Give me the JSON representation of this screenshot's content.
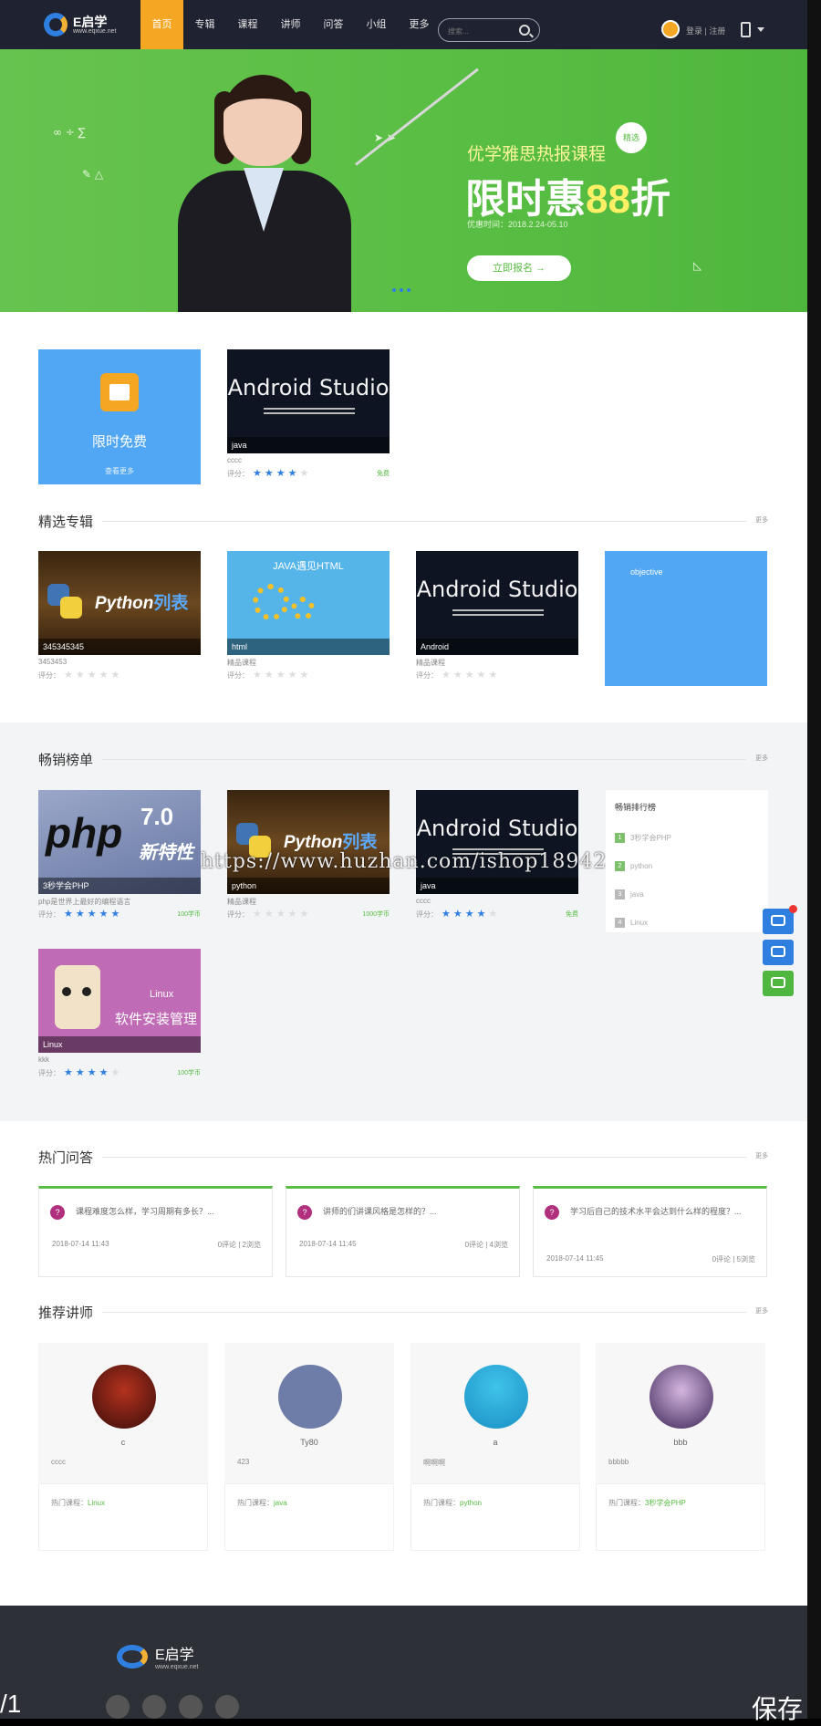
{
  "header": {
    "logo_name": "E启学",
    "logo_url": "www.eqxue.net",
    "menu": [
      "首页",
      "专辑",
      "课程",
      "讲师",
      "问答",
      "小组",
      "更多"
    ],
    "search_placeholder": "搜索...",
    "auth": "登录 | 注册"
  },
  "banner": {
    "subtitle": "优学雅思热报课程",
    "title_prefix": "限时惠",
    "title_number": "88",
    "title_suffix": "折",
    "date": "优惠时间：2018.2.24-05.10",
    "button": "立即报名 →",
    "badge": "精选"
  },
  "free": {
    "title": "限时免费",
    "more": "查看更多",
    "course": {
      "thumb": "Android Studio",
      "tag": "java",
      "title": "cccc",
      "rating_label": "评分：",
      "stars": 4,
      "price": "免费"
    }
  },
  "featured": {
    "title": "精选专辑",
    "more": "更多",
    "items": [
      {
        "tag": "345345345",
        "title": "3453453",
        "rating_label": "评分：",
        "stars": 0
      },
      {
        "tag": "html",
        "title": "精品课程",
        "rating_label": "评分：",
        "stars": 0,
        "banner_text": "JAVA遇见HTML"
      },
      {
        "tag": "Android",
        "title": "精品课程",
        "rating_label": "评分：",
        "stars": 0
      },
      {
        "tag": "objective",
        "title": "",
        "stars": 0
      }
    ]
  },
  "bestseller": {
    "title": "畅销榜单",
    "more": "更多",
    "items": [
      {
        "tag": "3秒学会PHP",
        "title": "php是世界上最好的编程语言",
        "rating_label": "评分：",
        "stars": 5,
        "price": "100学币"
      },
      {
        "tag": "python",
        "title": "精品课程",
        "rating_label": "评分：",
        "stars": 0,
        "price": "1000学币"
      },
      {
        "tag": "java",
        "title": "cccc",
        "rating_label": "评分：",
        "stars": 4,
        "price": "免费"
      },
      {
        "tag": "Linux",
        "title": "kkk",
        "rating_label": "评分：",
        "stars": 4,
        "price": "100学币",
        "line1": "Linux",
        "line2": "软件安装管理"
      }
    ],
    "rank": {
      "title": "畅销排行榜",
      "items": [
        {
          "no": "1",
          "name": "3秒学会PHP"
        },
        {
          "no": "2",
          "name": "python"
        },
        {
          "no": "3",
          "name": "java"
        },
        {
          "no": "4",
          "name": "Linux"
        }
      ]
    }
  },
  "qa": {
    "title": "热门问答",
    "more": "更多",
    "items": [
      {
        "q": "课程难度怎么样，学习周期有多长？...",
        "date": "2018-07-14 11:43",
        "stat": "0评论 | 2浏览"
      },
      {
        "q": "讲师的们讲课风格是怎样的？...",
        "date": "2018-07-14 11:45",
        "stat": "0评论 | 4浏览"
      },
      {
        "q": "学习后自己的技术水平会达到什么样的程度？...",
        "date": "2018-07-14 11:45",
        "stat": "0评论 | 5浏览"
      }
    ]
  },
  "teachers": {
    "title": "推荐讲师",
    "more": "更多",
    "hot_label": "热门课程：",
    "items": [
      {
        "name": "c",
        "desc": "cccc",
        "course": "Linux"
      },
      {
        "name": "Ty80",
        "desc": "423",
        "course": "java"
      },
      {
        "name": "a",
        "desc": "啊啊啊",
        "course": "python"
      },
      {
        "name": "bbb",
        "desc": "bbbbb",
        "course": "3秒学会PHP"
      }
    ]
  },
  "footer": {
    "logo_name": "E启学",
    "logo_url": "www.eqxue.net"
  },
  "common": {
    "android_studio": "Android Studio",
    "python_word": "Python",
    "python_cn": "列表",
    "php": "php",
    "php_ver": "7.0",
    "php_new": "新特性"
  },
  "overlay": {
    "watermark": "https://www.huzhan.com/ishop18942",
    "corner_left": "/1",
    "corner_right": "保存"
  }
}
